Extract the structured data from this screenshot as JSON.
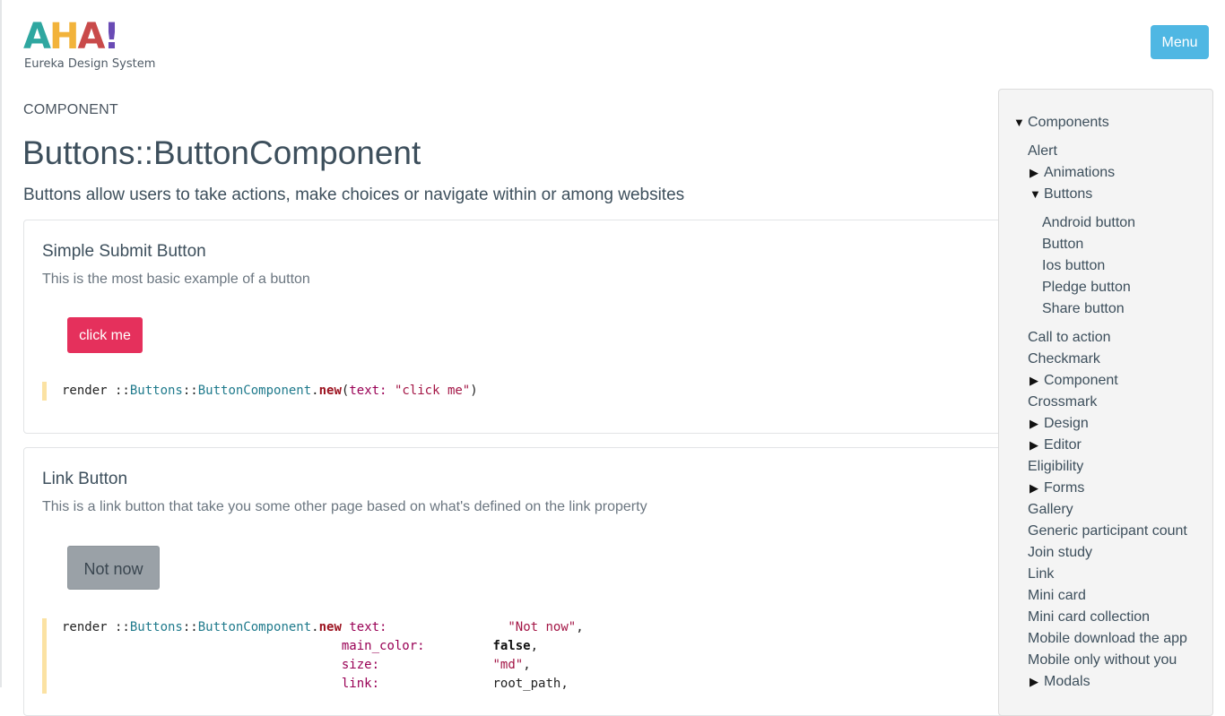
{
  "logo": {
    "letters": [
      "A",
      "H",
      "A",
      "!"
    ],
    "letter_colors": [
      "#2fa7a0",
      "#f2b33b",
      "#c94a4a",
      "#6a4bb5"
    ],
    "subtitle": "Eureka Design System"
  },
  "header": {
    "menu_label": "Menu"
  },
  "page": {
    "kicker": "COMPONENT",
    "title": "Buttons::ButtonComponent",
    "description": "Buttons allow users to take actions, make choices or navigate within or among websites"
  },
  "examples": [
    {
      "title": "Simple Submit Button",
      "description": "This is the most basic example of a button",
      "button_label": "click me",
      "button_color": "#e5305c",
      "code_lines": [
        [
          "render ::",
          "Buttons",
          "::",
          "ButtonComponent",
          ".",
          "new",
          "(",
          "text:",
          " ",
          "\"click me\"",
          ")"
        ]
      ]
    },
    {
      "title": "Link Button",
      "description": "This is a link button that take you some other page based on what's defined on the link property",
      "button_label": "Not now",
      "button_color": "#9aa1a7",
      "code": {
        "render": "render ::",
        "ns": "Buttons",
        "sep": "::",
        "cls": "ButtonComponent",
        "dot": ".",
        "new": "new",
        "params": [
          {
            "key": "text:",
            "value": "\"Not now\"",
            "trail": ","
          },
          {
            "key": "main_color:",
            "value": "false",
            "trail": ","
          },
          {
            "key": "size:",
            "value": "\"md\"",
            "trail": ","
          },
          {
            "key": "link:",
            "value": "root_path",
            "trail": ","
          }
        ]
      }
    }
  ],
  "sidebar": {
    "root": "Components",
    "items": [
      {
        "label": "Alert",
        "toggle": ""
      },
      {
        "label": "Animations",
        "toggle": "▶"
      },
      {
        "label": "Buttons",
        "toggle": "▼"
      },
      {
        "label": "Android button",
        "toggle": "",
        "child": true
      },
      {
        "label": "Button",
        "toggle": "",
        "child": true
      },
      {
        "label": "Ios button",
        "toggle": "",
        "child": true
      },
      {
        "label": "Pledge button",
        "toggle": "",
        "child": true
      },
      {
        "label": "Share button",
        "toggle": "",
        "child": true
      },
      {
        "label": "Call to action",
        "toggle": ""
      },
      {
        "label": "Checkmark",
        "toggle": ""
      },
      {
        "label": "Component",
        "toggle": "▶"
      },
      {
        "label": "Crossmark",
        "toggle": ""
      },
      {
        "label": "Design",
        "toggle": "▶"
      },
      {
        "label": "Editor",
        "toggle": "▶"
      },
      {
        "label": "Eligibility",
        "toggle": ""
      },
      {
        "label": "Forms",
        "toggle": "▶"
      },
      {
        "label": "Gallery",
        "toggle": ""
      },
      {
        "label": "Generic participant count",
        "toggle": ""
      },
      {
        "label": "Join study",
        "toggle": ""
      },
      {
        "label": "Link",
        "toggle": ""
      },
      {
        "label": "Mini card",
        "toggle": ""
      },
      {
        "label": "Mini card collection",
        "toggle": ""
      },
      {
        "label": "Mobile download the app",
        "toggle": ""
      },
      {
        "label": "Mobile only without you",
        "toggle": ""
      },
      {
        "label": "Modals",
        "toggle": "▶"
      }
    ]
  }
}
